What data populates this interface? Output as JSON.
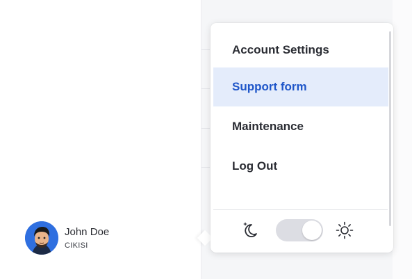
{
  "user": {
    "name": "John Doe",
    "role": "CIKISI",
    "avatar_icon": "user-avatar-icon"
  },
  "menu": {
    "items": [
      {
        "label": "Account Settings",
        "active": false
      },
      {
        "label": "Support form",
        "active": true
      },
      {
        "label": "Maintenance",
        "active": false
      },
      {
        "label": "Log Out",
        "active": false
      }
    ],
    "theme": {
      "dark_icon": "moon-icon",
      "light_icon": "sun-icon",
      "mode": "light"
    }
  },
  "colors": {
    "accent": "#1f56c9",
    "active_bg": "#e4ecfb",
    "avatar_bg": "#2f6fe0"
  }
}
